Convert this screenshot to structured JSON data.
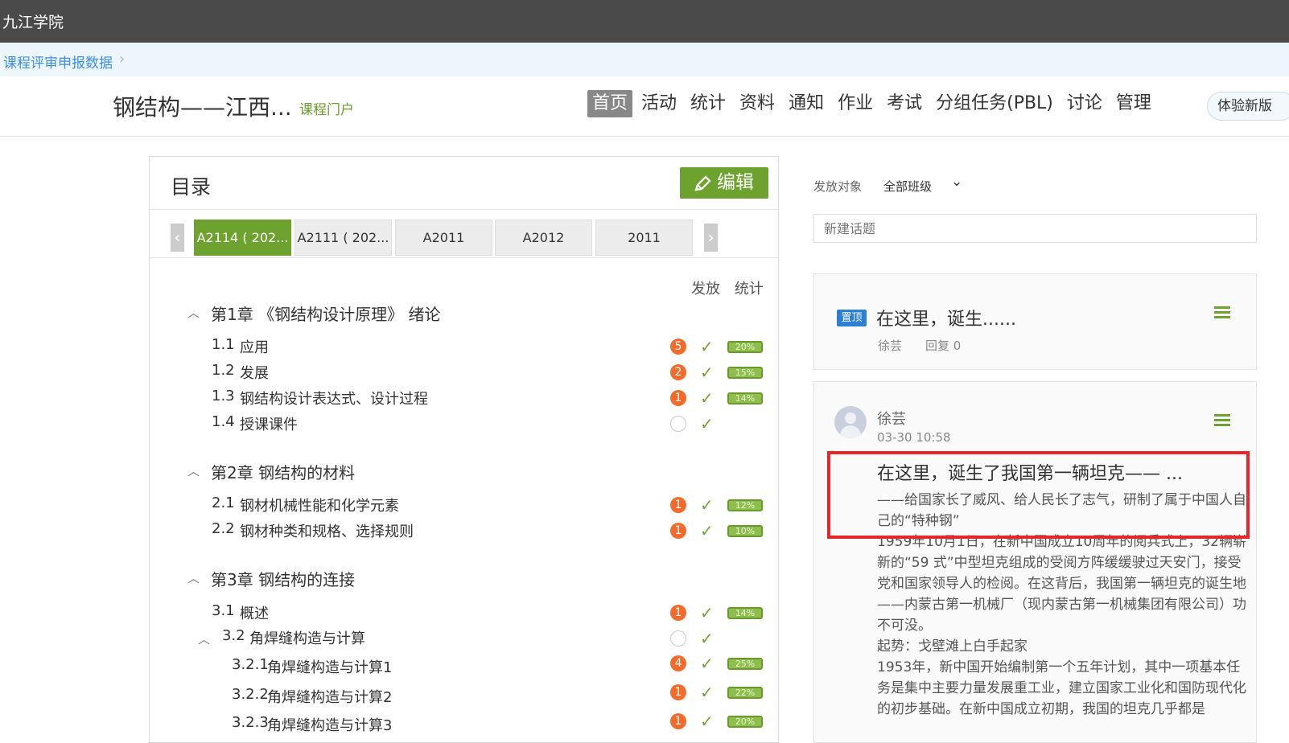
{
  "topbar": {
    "school": "九江学院"
  },
  "breadcrumb": {
    "label": "课程评审申报数据"
  },
  "header": {
    "course_title": "钢结构——江西...",
    "portal_label": "课程门户",
    "nav": [
      "首页",
      "活动",
      "统计",
      "资料",
      "通知",
      "作业",
      "考试",
      "分组任务(PBL)",
      "讨论",
      "管理"
    ],
    "trial_button": "体验新版"
  },
  "catalog": {
    "title": "目录",
    "edit_label": "编辑",
    "tabs": [
      "A2114 ( 202...",
      "A2111 ( 202...",
      "A2011",
      "A2012",
      "2011"
    ],
    "columns": [
      "发放",
      "统计"
    ],
    "chapters": [
      {
        "title": "第1章 《钢结构设计原理》 绪论"
      },
      {
        "title": "第2章 钢结构的材料"
      },
      {
        "title": "第3章 钢结构的连接"
      }
    ],
    "items": [
      {
        "num": "1.1",
        "label": "应用",
        "badge": "5",
        "pct": "20%"
      },
      {
        "num": "1.2",
        "label": "发展",
        "badge": "2",
        "pct": "15%"
      },
      {
        "num": "1.3",
        "label": "钢结构设计表达式、设计过程",
        "badge": "1",
        "pct": "14%"
      },
      {
        "num": "1.4",
        "label": "授课课件",
        "badge": "",
        "pct": ""
      },
      {
        "num": "2.1",
        "label": "钢材机械性能和化学元素",
        "badge": "1",
        "pct": "12%"
      },
      {
        "num": "2.2",
        "label": "钢材种类和规格、选择规则",
        "badge": "1",
        "pct": "10%"
      },
      {
        "num": "3.1",
        "label": "概述",
        "badge": "1",
        "pct": "14%"
      },
      {
        "num": "3.2",
        "label": "角焊缝构造与计算",
        "badge": "",
        "pct": ""
      },
      {
        "num": "3.2.1",
        "label": "角焊缝构造与计算1",
        "badge": "4",
        "pct": "25%"
      },
      {
        "num": "3.2.2",
        "label": "角焊缝构造与计算2",
        "badge": "1",
        "pct": "22%"
      },
      {
        "num": "3.2.3",
        "label": "角焊缝构造与计算3",
        "badge": "1",
        "pct": "20%"
      }
    ]
  },
  "discussion": {
    "target_label": "发放对象",
    "target_value": "全部班级",
    "new_topic_placeholder": "新建话题",
    "pinned": {
      "tag": "置顶",
      "title": "在这里，诞生......",
      "author": "徐芸",
      "replies": "回复 0"
    },
    "post": {
      "author": "徐芸",
      "time": "03-30 10:58",
      "title": "在这里，诞生了我国第一辆坦克—— ...",
      "subtitle": "——给国家长了威风、给人民长了志气，研制了属于中国人自己的“特种钢”",
      "body": [
        "1959年10月1日，在新中国成立10周年的阅兵式上，32辆崭新的“59 式”中型坦克组成的受阅方阵缓缓驶过天安门，接受党和国家领导人的检阅。在这背后，我国第一辆坦克的诞生地——内蒙古第一机械厂（现内蒙古第一机械集团有限公司）功不可没。",
        "起势：戈壁滩上白手起家",
        "1953年，新中国开始编制第一个五年计划，其中一项基本任务是集中主要力量发展重工业，建立国家工业化和国防现代化的初步基础。在新中国成立初期，我国的坦克几乎都是"
      ]
    }
  }
}
